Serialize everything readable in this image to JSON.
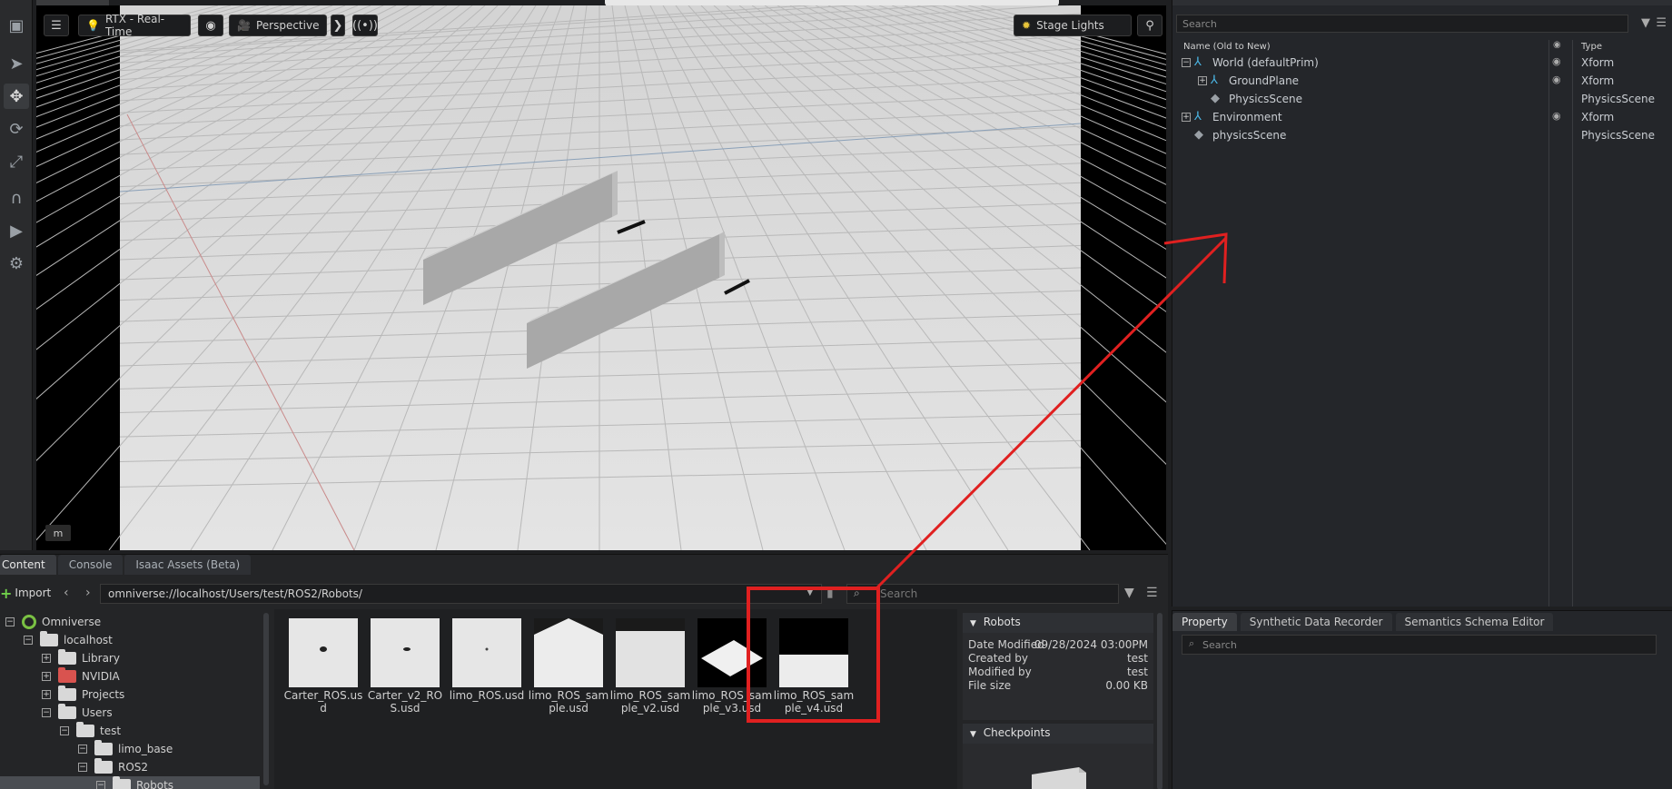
{
  "viewport": {
    "renderer_label": "RTX - Real-Time",
    "camera_label": "Perspective",
    "lights_label": "Stage Lights",
    "units_label": "m"
  },
  "stage": {
    "search_placeholder": "Search",
    "col_name": "Name (Old to New)",
    "col_type": "Type",
    "rows": [
      {
        "name": "World (defaultPrim)",
        "type": "Xform"
      },
      {
        "name": "GroundPlane",
        "type": "Xform"
      },
      {
        "name": "PhysicsScene",
        "type": "PhysicsScene"
      },
      {
        "name": "Environment",
        "type": "Xform"
      },
      {
        "name": "physicsScene",
        "type": "PhysicsScene"
      }
    ]
  },
  "property": {
    "tabs": [
      "Property",
      "Synthetic Data Recorder",
      "Semantics Schema Editor"
    ],
    "search_placeholder": "Search"
  },
  "content": {
    "tabs": [
      "Content",
      "Console",
      "Isaac Assets (Beta)"
    ],
    "import_label": "Import",
    "path": "omniverse://localhost/Users/test/ROS2/Robots/",
    "search_placeholder": "Search",
    "tree": [
      {
        "label": "Omniverse"
      },
      {
        "label": "localhost"
      },
      {
        "label": "Library"
      },
      {
        "label": "NVIDIA"
      },
      {
        "label": "Projects"
      },
      {
        "label": "Users"
      },
      {
        "label": "test"
      },
      {
        "label": "limo_base"
      },
      {
        "label": "ROS2"
      },
      {
        "label": "Robots"
      }
    ],
    "files": [
      {
        "label": "Carter_ROS.usd"
      },
      {
        "label": "Carter_v2_ROS.usd"
      },
      {
        "label": "limo_ROS.usd"
      },
      {
        "label": "limo_ROS_sample.usd"
      },
      {
        "label": "limo_ROS_sample_v2.usd"
      },
      {
        "label": "limo_ROS_sample_v3.usd"
      },
      {
        "label": "limo_ROS_sample_v4.usd"
      }
    ],
    "details": {
      "folder_title": "Robots",
      "date_modified_key": "Date Modified",
      "date_modified_val": "09/28/2024 03:00PM",
      "created_by_key": "Created by",
      "created_by_val": "test",
      "modified_by_key": "Modified by",
      "modified_by_val": "test",
      "file_size_key": "File size",
      "file_size_val": "0.00 KB",
      "checkpoints_title": "Checkpoints"
    }
  },
  "colors": {
    "annotation_red": "#e02020",
    "xform_icon": "#4bb7e6",
    "omniverse_green": "#7ac143"
  }
}
